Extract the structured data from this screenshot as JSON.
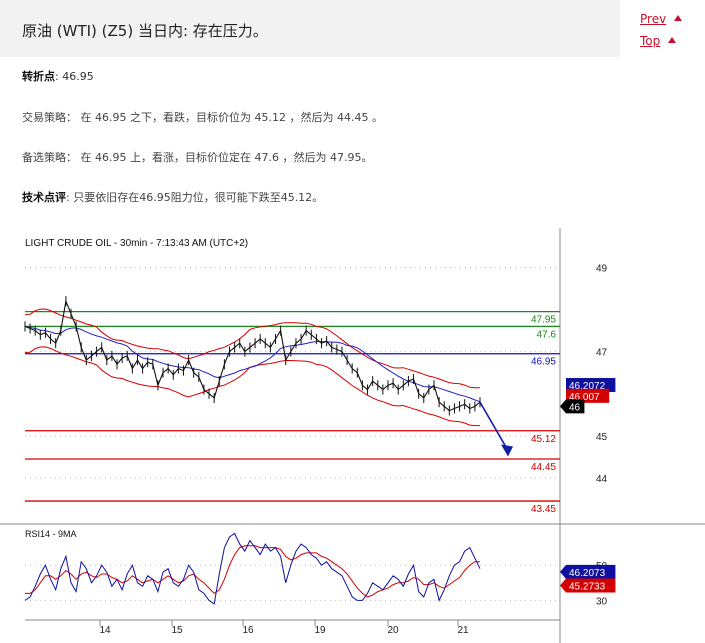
{
  "header": {
    "title": "原油 (WTI) (Z5) 当日内: 存在压力。"
  },
  "nav": {
    "prev": "Prev",
    "top": "Top"
  },
  "content": {
    "pivot_label": "转折点",
    "pivot_value": ": 46.95",
    "strategy_label": "交易策略",
    "strategy_text": "： 在 46.95 之下，看跌，目标价位为 45.12 ，然后为 44.45 。",
    "alt_label": "备选策略",
    "alt_text": "： 在 46.95 上，看涨，目标价位定在 47.6 ，然后为 47.95。",
    "comment_label": "技术点评",
    "comment_text": ": 只要依旧存在46.95阻力位，很可能下跌至45.12。"
  },
  "chart_data": {
    "type": "line",
    "title": "LIGHT CRUDE OIL - 30min - 7:13:43 AM (UTC+2)",
    "price_axis_ticks": [
      "49",
      "47",
      "45",
      "44"
    ],
    "x_tick_labels": [
      "14",
      "15",
      "16",
      "19",
      "20",
      "21"
    ],
    "levels": [
      {
        "label": "47.95",
        "value": 47.95,
        "color": "#1a8a1a"
      },
      {
        "label": "47.6",
        "value": 47.6,
        "color": "#1a8a1a"
      },
      {
        "label": "46.95",
        "value": 46.95,
        "color": "#1010c8"
      },
      {
        "label": "45.12",
        "value": 45.12,
        "color": "#d40000"
      },
      {
        "label": "44.45",
        "value": 44.45,
        "color": "#d40000"
      },
      {
        "label": "43.45",
        "value": 43.45,
        "color": "#d40000"
      }
    ],
    "price_badges": [
      {
        "label": "46.2072",
        "bg": "#1010a0",
        "fg": "#ffffff"
      },
      {
        "label": "46.007",
        "bg": "#d40000",
        "fg": "#ffffff"
      },
      {
        "label": "46",
        "bg": "#000000",
        "fg": "#ffffff"
      }
    ],
    "price_series": [
      47.6,
      47.55,
      47.5,
      47.4,
      47.45,
      47.3,
      47.2,
      47.5,
      48.2,
      47.9,
      47.6,
      47.1,
      46.8,
      46.9,
      47.0,
      47.1,
      46.8,
      46.9,
      46.7,
      46.85,
      46.9,
      46.6,
      46.8,
      46.6,
      46.75,
      46.7,
      46.2,
      46.5,
      46.6,
      46.45,
      46.6,
      46.55,
      46.8,
      46.5,
      46.4,
      46.1,
      46.0,
      45.9,
      46.3,
      46.7,
      47.0,
      47.1,
      47.2,
      47.0,
      47.1,
      47.2,
      47.3,
      47.2,
      47.1,
      47.3,
      47.5,
      46.8,
      47.0,
      47.2,
      47.3,
      47.5,
      47.4,
      47.3,
      47.2,
      47.25,
      47.1,
      47.05,
      47.0,
      46.8,
      46.6,
      46.5,
      46.2,
      46.1,
      46.3,
      46.2,
      46.1,
      46.2,
      46.25,
      46.1,
      46.2,
      46.3,
      46.35,
      46.0,
      45.9,
      46.1,
      46.2,
      45.8,
      45.7,
      45.6,
      45.65,
      45.7,
      45.75,
      45.65,
      45.7,
      45.8
    ],
    "rsi": {
      "label": "RSI14 - 9MA",
      "ticks": [
        "50",
        "30"
      ],
      "badges": [
        {
          "label": "46.2073",
          "bg": "#1010a0",
          "fg": "#ffffff"
        },
        {
          "label": "45.2733",
          "bg": "#d40000",
          "fg": "#ffffff"
        }
      ],
      "values": [
        30,
        32,
        38,
        45,
        50,
        42,
        36,
        48,
        55,
        40,
        35,
        52,
        48,
        40,
        44,
        50,
        46,
        38,
        42,
        36,
        45,
        50,
        40,
        38,
        44,
        42,
        35,
        46,
        48,
        40,
        38,
        42,
        50,
        46,
        36,
        34,
        30,
        28,
        45,
        60,
        66,
        68,
        62,
        58,
        64,
        60,
        56,
        62,
        58,
        60,
        55,
        40,
        50,
        58,
        62,
        60,
        56,
        54,
        50,
        52,
        48,
        46,
        44,
        38,
        32,
        30,
        30,
        34,
        40,
        38,
        36,
        40,
        44,
        42,
        38,
        45,
        50,
        35,
        32,
        40,
        42,
        30,
        36,
        44,
        50,
        52,
        58,
        60,
        54,
        48
      ],
      "ma_values": [
        34,
        34,
        36,
        40,
        44,
        44,
        42,
        44,
        47,
        45,
        42,
        45,
        46,
        44,
        43,
        45,
        45,
        43,
        42,
        40,
        41,
        44,
        42,
        40,
        41,
        42,
        40,
        42,
        44,
        42,
        40,
        41,
        44,
        45,
        42,
        40,
        37,
        34,
        36,
        42,
        50,
        56,
        60,
        61,
        61,
        61,
        60,
        60,
        60,
        60,
        59,
        55,
        53,
        54,
        56,
        57,
        57,
        57,
        55,
        54,
        52,
        50,
        48,
        45,
        41,
        37,
        34,
        32,
        33,
        35,
        36,
        37,
        39,
        40,
        40,
        41,
        43,
        42,
        39,
        39,
        40,
        38,
        37,
        39,
        41,
        43,
        47,
        50,
        52,
        52
      ]
    }
  }
}
